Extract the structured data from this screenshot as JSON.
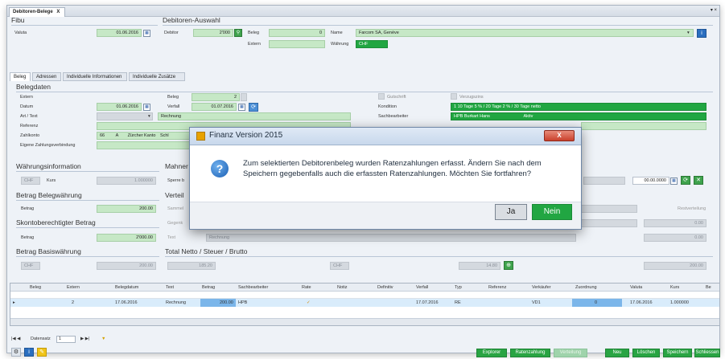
{
  "tab": {
    "title": "Debitoren-Belege",
    "close": "X",
    "corner": "▾ ×"
  },
  "fibu": {
    "title": "Fibu",
    "valuta_label": "Valuta",
    "valuta": "01.06.2016"
  },
  "auswahl": {
    "title": "Debitoren-Auswahl",
    "debitor_label": "Debitor",
    "debitor": "2'000",
    "beleg_label": "Beleg",
    "beleg": "0",
    "extern_label": "Extern",
    "name_label": "Name",
    "name": "Farcom SA, Genève",
    "waehrung_label": "Währung",
    "waehrung": "CHF"
  },
  "tabs": [
    "Beleg",
    "Adressen",
    "Individuelle Informationen",
    "Individuelle Zusätze"
  ],
  "belegdaten": {
    "title": "Belegdaten",
    "extern_label": "Extern",
    "datum_label": "Datum",
    "datum": "01.06.2016",
    "art_label": "Art / Text",
    "referenz_label": "Referenz",
    "zahlkonto_label": "Zahlkonto",
    "zahlkonto_nr": "66",
    "zahlkonto_a": "A",
    "zahlkonto_name": "Zürcher Kanto",
    "zahlkonto_extra": "Schl",
    "eigene_label": "Eigene Zahlungsverbindung",
    "beleg_label": "Beleg",
    "beleg": "2",
    "verfall_label": "Verfall",
    "verfall": "01.07.2016",
    "art_value": "Rechnung",
    "gutschrift": "Gutschrift",
    "verzugszins": "Verzugszins",
    "kondition_label": "Kondition",
    "kondition": "1  10 Tage 5 % / 20 Tage 2 % / 30 Tage netto",
    "sachbearbeiter_label": "Sachbearbeiter",
    "sachbearbeiter": "HPB   Burkart Hans",
    "sachbearbeiter_status": "Aktiv"
  },
  "waehrungsinfo": {
    "title": "Währungsinformation",
    "currency": "CHF",
    "kurs_label": "Kurs",
    "kurs": "1.000000"
  },
  "mahnen": {
    "title": "Mahner",
    "sperre": "Sperre b"
  },
  "betrag_beleg": {
    "title": "Betrag Belegwährung",
    "label": "Betrag",
    "value": "200.00"
  },
  "skonto": {
    "title": "Skontoberechtigter Betrag",
    "label": "Betrag",
    "value": "2'000.00"
  },
  "basis": {
    "title": "Betrag Basiswährung",
    "currency": "CHF",
    "value": "200.00"
  },
  "verteilung": {
    "title": "Verteil",
    "sammel": "Sammel",
    "gegenk": "Gegenk",
    "text_label": "Text",
    "text_value": "Rechnung",
    "restverteilung": "Restverteilung",
    "zero1": "0.00",
    "zero2": "0.00"
  },
  "right_block": {
    "date": "00.00.0000"
  },
  "total": {
    "title": "Total Netto / Steuer / Brutto",
    "netto": "185.20",
    "currency": "CHF",
    "steuer": "14.80",
    "brutto": "200.00"
  },
  "grid": {
    "columns": [
      "Beleg",
      "Extern",
      "Belegdatum",
      "Text",
      "Betrag",
      "Sachbearbeiter",
      "Rate",
      "Notiz",
      "Definitiv",
      "Verfall",
      "Typ",
      "Referenz",
      "Verkäufer",
      "Zuordnung",
      "Valuta",
      "Kurs",
      "Be"
    ],
    "row": {
      "beleg": "2",
      "belegdatum": "17.06.2016",
      "text": "Rechnung",
      "betrag": "200.00",
      "sachbearbeiter": "HPB",
      "verfall": "17.07.2016",
      "typ": "RE",
      "verkaeufer": "VD1",
      "zuordnung": "0",
      "valuta": "17.06.2016",
      "kurs": "1.000000"
    }
  },
  "nav": {
    "datensatz_label": "Datensatz",
    "datensatz": "1"
  },
  "bottom_buttons": [
    "Explorer",
    "Ratenzahlung",
    "Verteilung",
    "Neu",
    "Löschen",
    "Speichern",
    "Schliessen"
  ],
  "dialog": {
    "title": "Finanz Version 2015",
    "close": "X",
    "message": "Zum selektierten Debitorenbeleg wurden Ratenzahlungen erfasst. Ändern Sie nach dem Speichern gegebenfalls auch die erfassten Ratenzahlungen. Möchten Sie fortfahren?",
    "ja": "Ja",
    "nein": "Nein",
    "accent": "#21a642"
  }
}
